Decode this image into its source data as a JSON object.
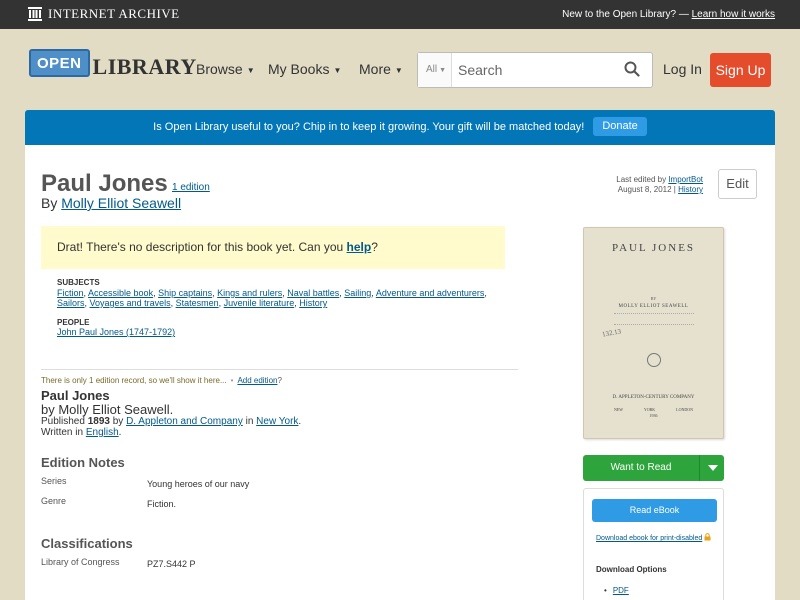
{
  "ia_bar": {
    "logo_text": "INTERNET ARCHIVE",
    "prompt": "New to the Open Library? — ",
    "prompt_link": "Learn how it works"
  },
  "header": {
    "logo_open": "OPEN",
    "logo_library": "LIBRARY",
    "nav": [
      {
        "label": "Browse"
      },
      {
        "label": "My Books"
      },
      {
        "label": "More"
      }
    ],
    "search_scope": "All",
    "search_placeholder": "Search",
    "login": "Log In",
    "signup": "Sign Up"
  },
  "banner": {
    "text": "Is Open Library useful to you? Chip in to keep it growing. Your gift will be matched today!",
    "donate": "Donate"
  },
  "work": {
    "title": "Paul Jones",
    "edition_link": "1 edition",
    "by": "By ",
    "author": "Molly Elliot Seawell",
    "last_edited_prefix": "Last edited by ",
    "last_edited_by": "ImportBot",
    "last_edited_date": "August 8, 2012",
    "history": "History",
    "edit": "Edit",
    "no_description_prefix": "Drat! There's no description for this book yet. Can you ",
    "help": "help",
    "no_description_suffix": "?",
    "subjects_label": "SUBJECTS",
    "subjects": [
      "Fiction",
      "Accessible book",
      "Ship captains",
      "Kings and rulers",
      "Naval battles",
      "Sailing",
      "Adventure and adventurers",
      "Sailors",
      "Voyages and travels",
      "Statesmen",
      "Juvenile literature",
      "History"
    ],
    "people_label": "PEOPLE",
    "people": [
      "John Paul Jones (1747-1792)"
    ]
  },
  "edition": {
    "note": "There is only 1 edition record, so we'll show it here...",
    "add_edition": "Add edition",
    "q": "?",
    "title": "Paul Jones",
    "by": "by Molly Elliot Seawell.",
    "published_prefix": "Published ",
    "year": "1893",
    "by_word": " by ",
    "publisher": "D. Appleton and Company",
    "in_word": " in ",
    "place": "New York",
    "period": ".",
    "written_prefix": "Written in ",
    "language": "English",
    "notes_heading": "Edition Notes",
    "series_label": "Series",
    "series_value": "Young heroes of our navy",
    "genre_label": "Genre",
    "genre_value": "Fiction.",
    "class_heading": "Classifications",
    "loc_label": "Library of Congress",
    "loc_value": "PZ7.S442 P"
  },
  "cover": {
    "title": "PAUL JONES",
    "by": "BY",
    "author": "MOLLY ELLIOT SEAWELL",
    "handwriting": "132.13",
    "publisher": "D. APPLETON-CENTURY COMPANY",
    "city_left": "NEW YORK",
    "city_right": "LONDON",
    "year": "1936"
  },
  "sidebar": {
    "want_to_read": "Want to Read",
    "read_ebook": "Read eBook",
    "daisy": "Download ebook for print-disabled",
    "download_heading": "Download Options",
    "pdf": "PDF"
  }
}
